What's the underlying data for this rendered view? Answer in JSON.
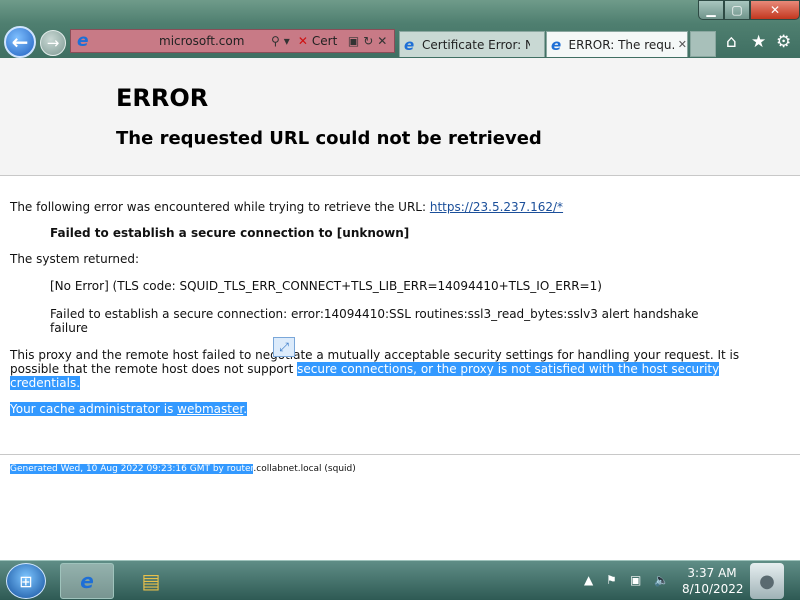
{
  "browser": {
    "address_url": "microsoft.com",
    "cert_label": "Cert",
    "tabs": [
      {
        "label": "Certificate Error: Nav..."
      },
      {
        "label": "ERROR: The requ..."
      }
    ],
    "toolbar_icons": [
      "home-icon",
      "star-icon",
      "gear-icon"
    ]
  },
  "page": {
    "title": "ERROR",
    "subtitle": "The requested URL could not be retrieved",
    "intro_text": "The following error was encountered while trying to retrieve the URL: ",
    "intro_link": "https://23.5.237.162/*",
    "bold_msg": "Failed to establish a secure connection to [unknown]",
    "system_returned": "The system returned:",
    "tls_code": "[No Error] (TLS code: SQUID_TLS_ERR_CONNECT+TLS_LIB_ERR=14094410+TLS_IO_ERR=1)",
    "failed_detail": "Failed to establish a secure connection: error:14094410:SSL routines:ssl3_read_bytes:sslv3 alert handshake failure",
    "proxy_line_plain": "This proxy and the remote host failed to negotiate a mutually acceptable security settings for handling your request. It is possible that the remote host does not support ",
    "proxy_line_hl": "secure connections, or the proxy is not satisfied with the host security credentials.",
    "admin_prefix": "Your cache administrator is ",
    "admin_link": "webmaster",
    "admin_suffix": ".",
    "footer_hl": "Generated Wed, 10 Aug 2022 09:23:16 GMT by router",
    "footer_rest": ".collabnet.local (squid)"
  },
  "taskbar": {
    "time": "3:37 AM",
    "date": "8/10/2022"
  }
}
